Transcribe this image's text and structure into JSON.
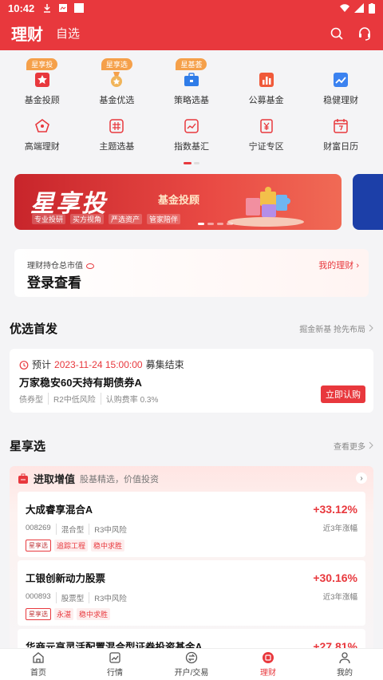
{
  "status": {
    "time": "10:42"
  },
  "header": {
    "title": "理财",
    "tab2": "自选"
  },
  "menu": {
    "row1": [
      {
        "label": "基金投顾",
        "badge": "星享投",
        "icon": "star-box-icon"
      },
      {
        "label": "基金优选",
        "badge": "星享选",
        "icon": "medal-icon"
      },
      {
        "label": "策略选基",
        "badge": "星基荟",
        "icon": "briefcase-icon"
      },
      {
        "label": "公募基金",
        "badge": "",
        "icon": "bar-chart-icon"
      },
      {
        "label": "稳健理财",
        "badge": "",
        "icon": "trend-icon"
      }
    ],
    "row2": [
      {
        "label": "高端理财",
        "icon": "pentagon-icon"
      },
      {
        "label": "主题选基",
        "icon": "grid-icon"
      },
      {
        "label": "指数基汇",
        "icon": "index-icon"
      },
      {
        "label": "宁证专区",
        "icon": "yen-icon"
      },
      {
        "label": "财富日历",
        "icon": "calendar-icon"
      }
    ]
  },
  "banner": {
    "title": "星享投",
    "subtitle": "基金投顾",
    "tags": [
      "专业投研",
      "买方视角",
      "严选资产",
      "管家陪伴"
    ]
  },
  "login": {
    "caption": "理财持仓总市值",
    "main": "登录查看",
    "my": "我的理财 ›"
  },
  "featured": {
    "title": "优选首发",
    "more": "掘金新基 抢先布局",
    "product": {
      "prefix": "预计",
      "datetime": "2023-11-24 15:00:00",
      "suffix": "募集结束",
      "name": "万家稳安60天持有期债券A",
      "tags": [
        "债券型",
        "R2中低风险",
        "认购费率 0.3%"
      ],
      "button": "立即认购"
    }
  },
  "star": {
    "title": "星享选",
    "more": "查看更多",
    "panel_title": "进取增值",
    "panel_sub": "股基精选，价值投资",
    "funds": [
      {
        "name": "大成睿享混合A",
        "code": "008269",
        "type": "混合型",
        "risk": "R3中风险",
        "tags": [
          "星享选",
          "追踪工程",
          "稳中求胜"
        ],
        "value": "+33.12%",
        "label": "近3年涨幅"
      },
      {
        "name": "工银创新动力股票",
        "code": "000893",
        "type": "股票型",
        "risk": "R3中风险",
        "tags": [
          "星享选",
          "永湛",
          "稳中求胜"
        ],
        "value": "+30.16%",
        "label": "近3年涨幅"
      },
      {
        "name": "华商元亨灵活配置混合型证券投资基金A",
        "code": "",
        "type": "",
        "risk": "",
        "tags": [],
        "value": "+27.81%",
        "label": ""
      }
    ]
  },
  "nav": [
    {
      "label": "首页",
      "icon": "home-icon"
    },
    {
      "label": "行情",
      "icon": "chart-icon"
    },
    {
      "label": "开户/交易",
      "icon": "exchange-icon"
    },
    {
      "label": "理财",
      "icon": "wealth-icon"
    },
    {
      "label": "我的",
      "icon": "person-icon"
    }
  ],
  "colors": {
    "brand": "#e8383d",
    "accent": "#f5a04a"
  }
}
